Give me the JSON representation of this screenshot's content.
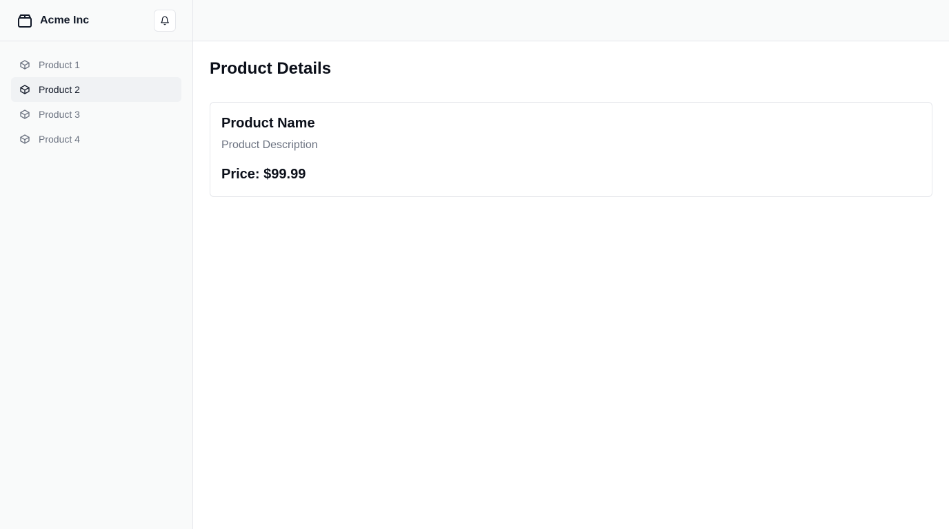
{
  "sidebar": {
    "brand": {
      "name": "Acme Inc",
      "icon": "package-icon"
    },
    "notifications_icon": "bell-icon",
    "items": [
      {
        "label": "Product 1",
        "icon": "cube-icon",
        "active": false
      },
      {
        "label": "Product 2",
        "icon": "cube-icon",
        "active": true
      },
      {
        "label": "Product 3",
        "icon": "cube-icon",
        "active": false
      },
      {
        "label": "Product 4",
        "icon": "cube-icon",
        "active": false
      }
    ]
  },
  "main": {
    "title": "Product Details",
    "card": {
      "name": "Product Name",
      "description": "Product Description",
      "price": "Price: $99.99"
    }
  },
  "colors": {
    "sidebar_bg": "#f9fafa",
    "active_item_bg": "#f0f2f4",
    "muted_text": "#6b7280",
    "border": "#e5e7eb"
  }
}
